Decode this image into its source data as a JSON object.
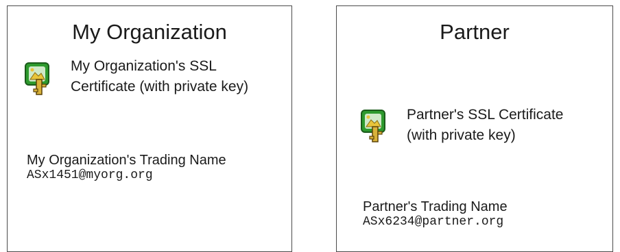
{
  "panels": [
    {
      "title": "My Organization",
      "certificate": {
        "icon": "certificate-icon",
        "label_line1": "My Organization's SSL",
        "label_line2": "Certificate (with private key)"
      },
      "trading_name_label": "My Organization's Trading Name",
      "trading_name_value": "ASx1451@myorg.org"
    },
    {
      "title": "Partner",
      "certificate": {
        "icon": "certificate-icon",
        "label_line1": "Partner's SSL Certificate",
        "label_line2": "(with private key)"
      },
      "trading_name_label": "Partner's Trading Name",
      "trading_name_value": "ASx6234@partner.org"
    }
  ],
  "colors": {
    "border": "#4a4a4a",
    "icon_green": "#2e9a2e",
    "icon_yellow": "#e8c43a",
    "text": "#1a1a1a"
  }
}
